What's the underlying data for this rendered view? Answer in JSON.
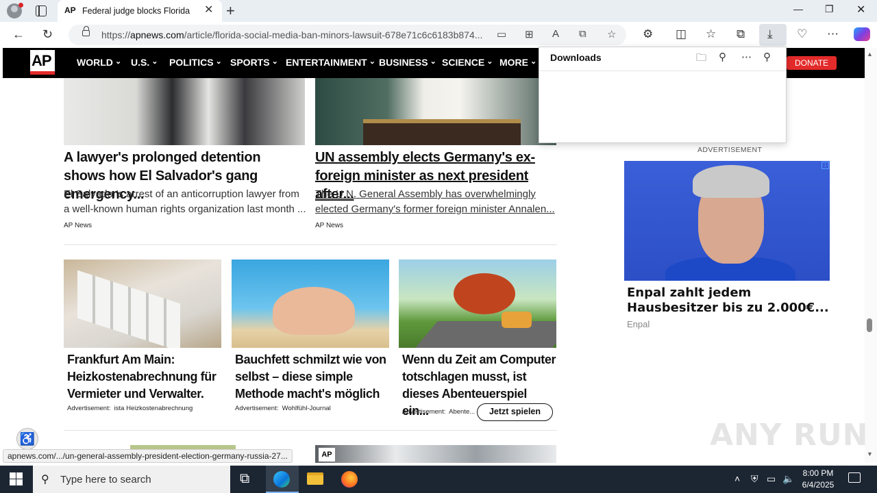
{
  "browser": {
    "tab_title": "Federal judge blocks Florida from",
    "tab_favicon": "AP",
    "url_prefix": "https://",
    "url_domain": "apnews.com",
    "url_path": "/article/florida-social-media-ban-minors-lawsuit-678e71c6c6183b874...",
    "icons": [
      "back-icon",
      "refresh-icon",
      "lock-icon",
      "reader-icon",
      "apps-icon",
      "read-aloud-icon",
      "immersive-icon",
      "favorite-star-icon",
      "extensions-icon",
      "split-screen-icon",
      "favorites-icon",
      "collections-icon",
      "download-icon",
      "browser-essentials-icon",
      "more-icon",
      "copilot-icon"
    ]
  },
  "apnav": {
    "logo": "AP",
    "items": [
      "WORLD",
      "U.S.",
      "POLITICS",
      "SPORTS",
      "ENTERTAINMENT",
      "BUSINESS",
      "SCIENCE",
      "MORE"
    ],
    "donate": "DONATE"
  },
  "downloads": {
    "title": "Downloads"
  },
  "articles": [
    {
      "title": "A lawyer's prolonged detention shows how El Salvador's gang emergency...",
      "desc": "El Salvador's arrest of an anticorruption lawyer from a well-known human rights organization last month ...",
      "source": "AP News"
    },
    {
      "title": "UN assembly elects Germany's ex-foreign minister as next president after...",
      "desc": "The U.N. General Assembly has overwhelmingly elected Germany's former foreign minister Annalen...",
      "source": "AP News"
    }
  ],
  "ads": [
    {
      "title": "Frankfurt Am Main: Heizkostenabrechnung für Vermieter und Verwalter.",
      "label": "Advertisement:",
      "source": "ista Heizkostenabrechnung"
    },
    {
      "title": "Bauchfett schmilzt wie von selbst – diese simple Methode macht's möglich",
      "label": "Advertisement:",
      "source": "Wohlfühl-Journal"
    },
    {
      "title": "Wenn du Zeit am Computer totschlagen musst, ist dieses Abenteuerspiel ein...",
      "label": "Advertisement:",
      "source": "Abente...",
      "cta": "Jetzt spielen"
    }
  ],
  "bottom_thumb": {
    "badge": "AP"
  },
  "sidebar_ad": {
    "label": "ADVERTISEMENT",
    "info": "i",
    "title": "Enpal zahlt jedem Hausbesitzer bis zu 2.000€...",
    "source": "Enpal"
  },
  "status_url": "apnews.com/.../un-general-assembly-president-election-germany-russia-27...",
  "watermark": "ANY RUN",
  "taskbar": {
    "search_placeholder": "Type here to search",
    "time": "8:00 PM",
    "date": "6/4/2025"
  }
}
